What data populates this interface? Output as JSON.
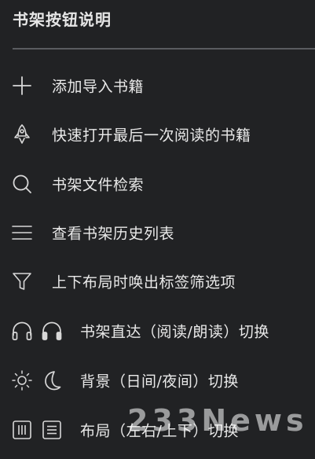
{
  "panel": {
    "title": "书架按钮说明"
  },
  "items": [
    {
      "icon": "plus-icon",
      "label": "添加导入书籍"
    },
    {
      "icon": "rocket-icon",
      "label": "快速打开最后一次阅读的书籍"
    },
    {
      "icon": "search-icon",
      "label": "书架文件检索"
    },
    {
      "icon": "menu-lines-icon",
      "label": "查看书架历史列表"
    },
    {
      "icon": "filter-icon",
      "label": "上下布局时唤出标签筛选项"
    },
    {
      "icon": "headphones-icon",
      "label": "书架直达（阅读/朗读）切换"
    },
    {
      "icon": "sun-moon-icon",
      "label": "背景（日间/夜间）切换"
    },
    {
      "icon": "layout-icon",
      "label": "布局（左右/上下）切换"
    }
  ],
  "watermark": "233News",
  "colors": {
    "background": "#212224",
    "text": "#e9e9e9",
    "divider": "#5a5c60"
  }
}
